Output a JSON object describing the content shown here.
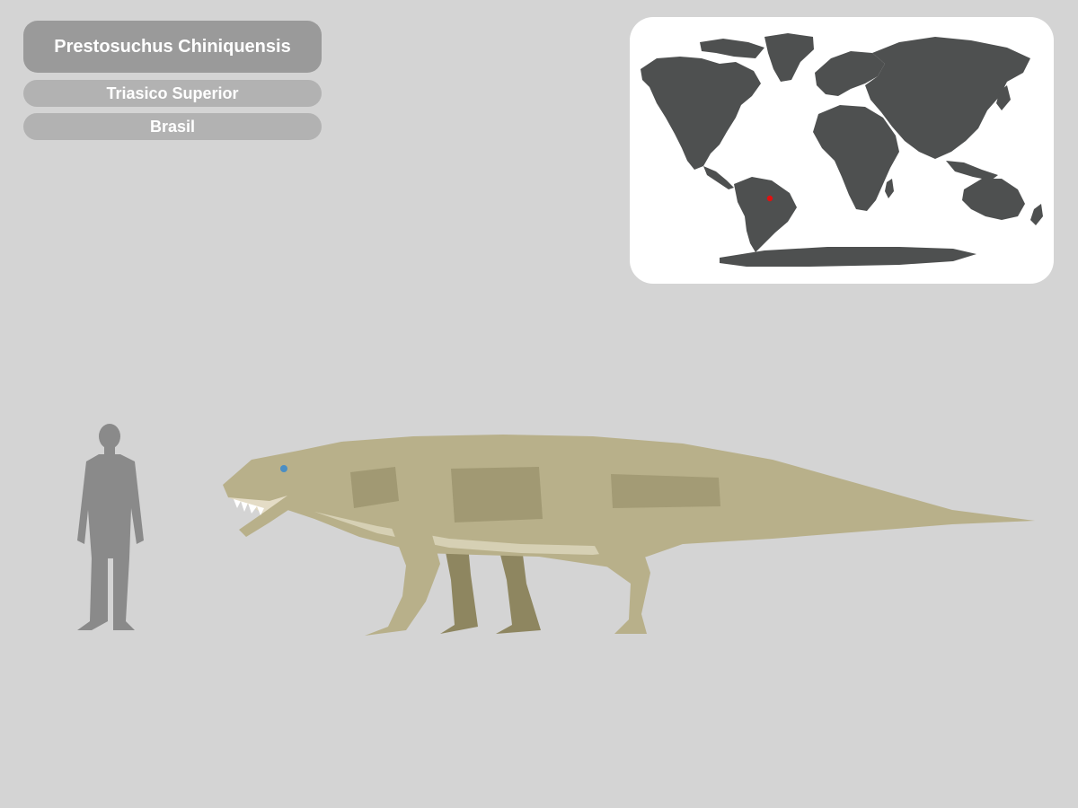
{
  "colors": {
    "background": "#d4d4d4",
    "name_pill": "#9a9a9a",
    "info_pill": "#b2b2b2",
    "map_card": "#ffffff",
    "land": "#4e5050",
    "location_marker": "#e01010",
    "human_silhouette": "#8a8a8a",
    "creature_body": "#b8b08a",
    "creature_shade": "#8e8660",
    "creature_belly": "#d6d0b4"
  },
  "species": {
    "name": "Prestosuchus Chiniquensis",
    "period": "Triasico Superior",
    "country": "Brasil"
  },
  "map": {
    "icon": "world-map",
    "marker_icon": "location-marker"
  },
  "scale": {
    "human_icon": "human-silhouette",
    "creature_icon": "prestosuchus-illustration"
  }
}
